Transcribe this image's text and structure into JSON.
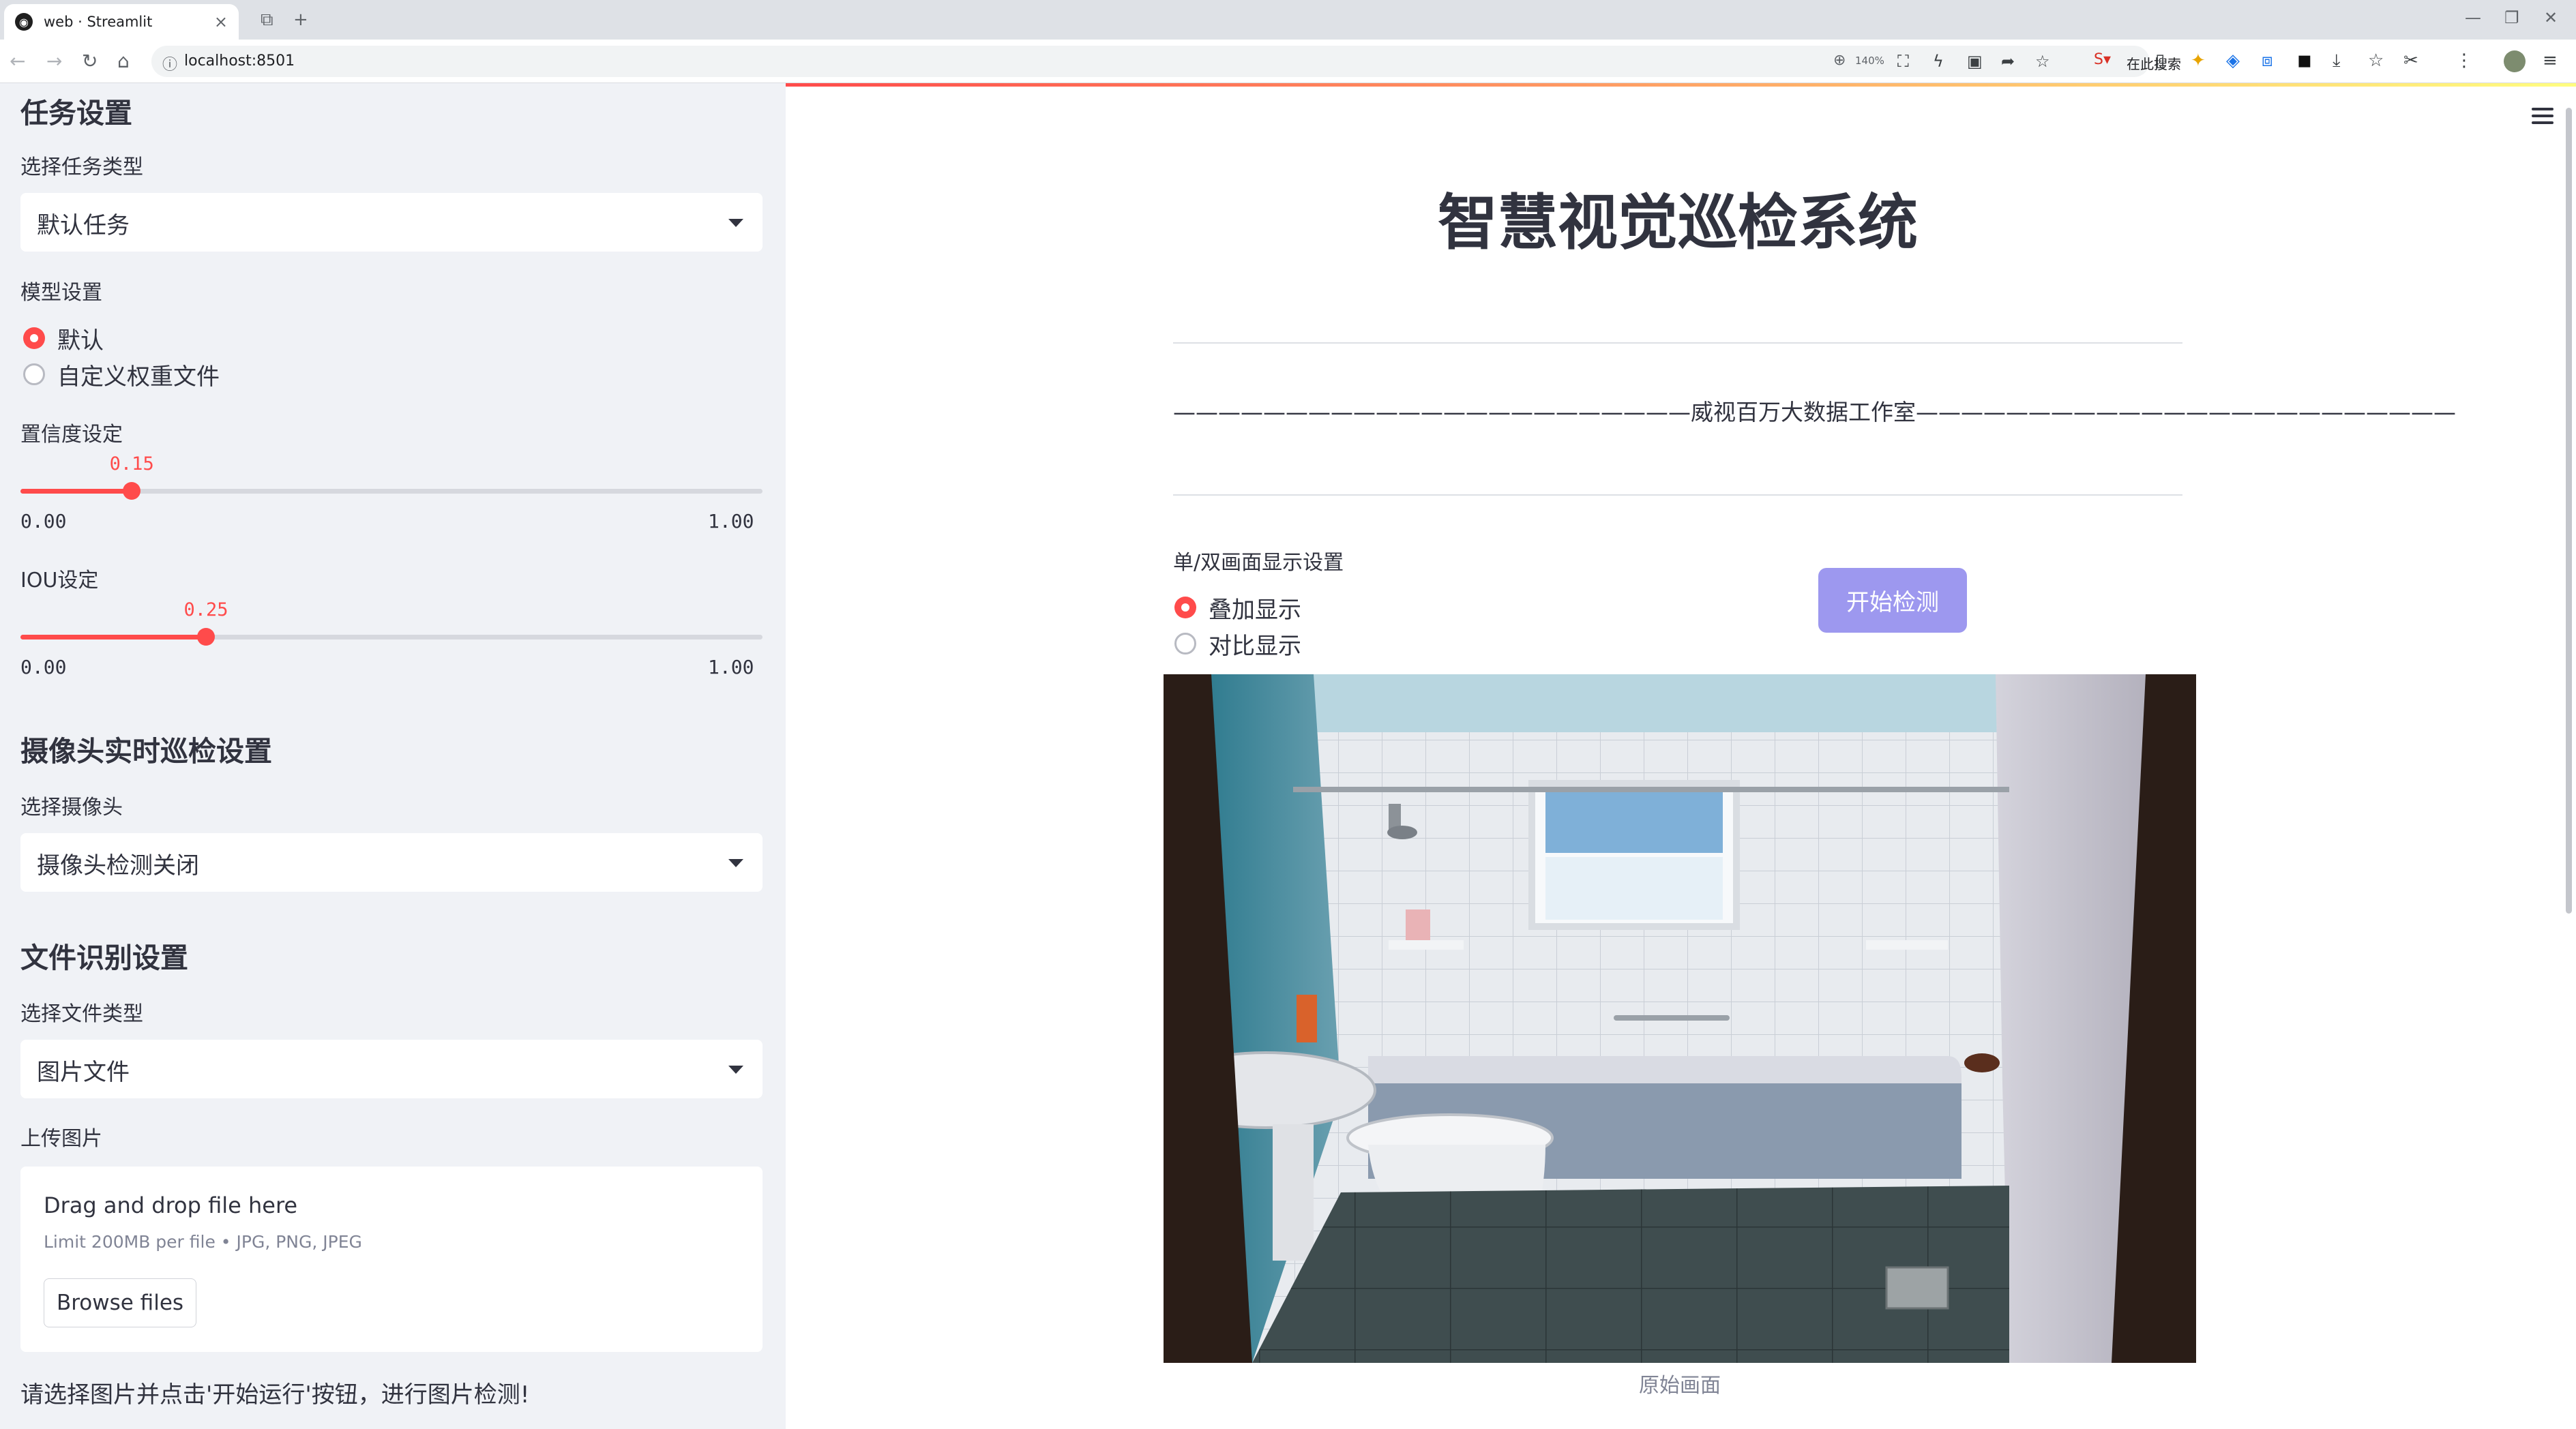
{
  "browser": {
    "tab_title": "web · Streamlit",
    "url": "localhost:8501",
    "zoom": "140%",
    "search_placeholder": "在此搜索"
  },
  "sidebar": {
    "task_section": {
      "heading": "任务设置",
      "task_type_label": "选择任务类型",
      "task_type_value": "默认任务"
    },
    "model_section": {
      "label": "模型设置",
      "options": [
        "默认",
        "自定义权重文件"
      ],
      "selected": "默认"
    },
    "confidence": {
      "label": "置信度设定",
      "value": "0.15",
      "fraction": 0.15,
      "min": "0.00",
      "max": "1.00"
    },
    "iou": {
      "label": "IOU设定",
      "value": "0.25",
      "fraction": 0.25,
      "min": "0.00",
      "max": "1.00"
    },
    "camera_section": {
      "heading": "摄像头实时巡检设置",
      "label": "选择摄像头",
      "value": "摄像头检测关闭"
    },
    "file_section": {
      "heading": "文件识别设置",
      "file_type_label": "选择文件类型",
      "file_type_value": "图片文件",
      "upload_label": "上传图片",
      "drop_text": "Drag and drop file here",
      "limit_text": "Limit 200MB per file • JPG, PNG, JPEG",
      "browse_label": "Browse files"
    },
    "note": "请选择图片并点击'开始运行'按钮，进行图片检测!"
  },
  "main": {
    "title": "智慧视觉巡检系统",
    "studio_line": "———————————————————————威视百万大数据工作室————————————————————————",
    "display_label": "单/双画面显示设置",
    "display_options": [
      "叠加显示",
      "对比显示"
    ],
    "display_selected": "叠加显示",
    "start_button": "开始检测",
    "image_caption": "原始画面"
  },
  "colors": {
    "accent": "#ff4b4b",
    "button": "#9d98ef",
    "sidebar_bg": "#f0f2f6"
  }
}
